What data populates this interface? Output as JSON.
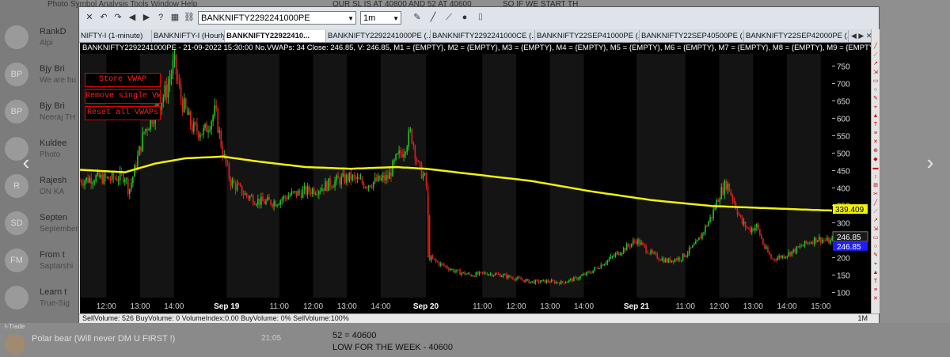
{
  "background": {
    "chats": [
      {
        "avatar": "",
        "title": "RankD",
        "sub": "Alpi"
      },
      {
        "avatar": "BP",
        "title": "Bjy Bri",
        "sub": "We are bu"
      },
      {
        "avatar": "BP",
        "title": "Bjy Bri",
        "sub": "Neeraj TH"
      },
      {
        "avatar": "",
        "title": "Kuldee",
        "sub": "Photo"
      },
      {
        "avatar": "R",
        "title": "Rajesh",
        "sub": "ON KA"
      },
      {
        "avatar": "SD",
        "title": "Septen",
        "sub": "September"
      },
      {
        "avatar": "FM",
        "title": "From t",
        "sub": "Saptarshi"
      },
      {
        "avatar": "",
        "title": "Learn t",
        "sub": "True-Sig"
      }
    ],
    "menu_text": "Photo   Symbol   Analysis   Tools   Window   Help",
    "top_msg_1": "OUR SL IS AT 40800 AND 52 AT 40600",
    "top_msg_2": "SO IF WE START TH",
    "bottom_sender": "Polar bear (Will never DM U FIRST !)",
    "bottom_time": "21:05",
    "bottom_line_1": "52 = 40600",
    "bottom_line_2": "LOW FOR THE WEEK - 40600",
    "app_label": "I-Trade"
  },
  "toolbar": {
    "symbol": "BANKNIFTY2292241000PE",
    "timeframe": "1m",
    "icons": [
      "close-icon",
      "undo-icon",
      "redo-icon",
      "back-icon",
      "forward-icon",
      "help-icon",
      "grid-icon",
      "link-icon"
    ]
  },
  "tabs": [
    {
      "label": "NIFTY-I (1-minute)",
      "active": false
    },
    {
      "label": "BANKNIFTY-I (Hourly)",
      "active": false
    },
    {
      "label": "BANKNIFTY22922410...",
      "active": true
    },
    {
      "label": "BANKNIFTY2292241000PE (...",
      "active": false
    },
    {
      "label": "BANKNIFTY2292241000CE (...",
      "active": false
    },
    {
      "label": "BANKNIFTY22SEP41000PE (...",
      "active": false
    },
    {
      "label": "BANKNIFTY22SEP40500PE (...",
      "active": false
    },
    {
      "label": "BANKNIFTY22SEP42000PE (...",
      "active": false
    }
  ],
  "info_bar": "BANKNIFTY2292241000PE - 21-09-2022 15:30:00 No.VWAPs: 34 Close:  246.85, V: 246.85, M1 = {EMPTY}, M2 = {EMPTY}, M3 = {EMPTY}, M4 = {EMPTY}, M5 = {EMPTY}, M6 = {EMPTY}, M7 = {EMPTY}, M8 = {EMPTY}, M9 = {EMPTY}, M10",
  "buttons": {
    "store_vwap": "Store VWAP",
    "remove_single": "Remove single VWAP",
    "reset_all": "Reset all VWAPs"
  },
  "status_bar": "SellVolume:  526   BuyVolume:    0   VolumeIndex:0.00   BuyVolume: 0%   SellVolume:100%",
  "status_right": "1M",
  "colors": {
    "up": "#22c322",
    "down": "#e02020",
    "vwap": "#f2f20a",
    "vwap_label_bg": "#f2f20a",
    "price_label_bg": "#1c1cff"
  },
  "chart_data": {
    "type": "line",
    "title": "",
    "y_ticks": [
      100,
      150,
      200,
      250,
      300,
      350,
      400,
      450,
      500,
      550,
      600,
      650,
      700,
      750
    ],
    "ylim": [
      85,
      785
    ],
    "x_ticks": [
      {
        "label": "12:00",
        "x": 0.035
      },
      {
        "label": "13:00",
        "x": 0.08
      },
      {
        "label": "14:00",
        "x": 0.125
      },
      {
        "label": "Sep 19",
        "x": 0.195,
        "bold": true
      },
      {
        "label": "11:00",
        "x": 0.265
      },
      {
        "label": "12:00",
        "x": 0.31
      },
      {
        "label": "13:00",
        "x": 0.355
      },
      {
        "label": "14:00",
        "x": 0.4
      },
      {
        "label": "Sep 20",
        "x": 0.46,
        "bold": true
      },
      {
        "label": "11:00",
        "x": 0.535
      },
      {
        "label": "12:00",
        "x": 0.58
      },
      {
        "label": "13:00",
        "x": 0.625
      },
      {
        "label": "14:00",
        "x": 0.67
      },
      {
        "label": "Sep 21",
        "x": 0.74,
        "bold": true
      },
      {
        "label": "11:00",
        "x": 0.805
      },
      {
        "label": "12:00",
        "x": 0.85
      },
      {
        "label": "13:00",
        "x": 0.895
      },
      {
        "label": "14:00",
        "x": 0.94
      },
      {
        "label": "15:00",
        "x": 0.985
      }
    ],
    "price_path": [
      [
        0.0,
        420
      ],
      [
        0.02,
        430
      ],
      [
        0.04,
        425
      ],
      [
        0.06,
        435
      ],
      [
        0.065,
        390
      ],
      [
        0.075,
        470
      ],
      [
        0.085,
        560
      ],
      [
        0.1,
        620
      ],
      [
        0.115,
        680
      ],
      [
        0.125,
        760
      ],
      [
        0.135,
        650
      ],
      [
        0.15,
        570
      ],
      [
        0.165,
        560
      ],
      [
        0.18,
        620
      ],
      [
        0.19,
        500
      ],
      [
        0.2,
        420
      ],
      [
        0.22,
        380
      ],
      [
        0.24,
        360
      ],
      [
        0.26,
        360
      ],
      [
        0.28,
        380
      ],
      [
        0.3,
        390
      ],
      [
        0.32,
        400
      ],
      [
        0.34,
        420
      ],
      [
        0.36,
        430
      ],
      [
        0.38,
        410
      ],
      [
        0.395,
        420
      ],
      [
        0.41,
        430
      ],
      [
        0.42,
        480
      ],
      [
        0.43,
        510
      ],
      [
        0.44,
        560
      ],
      [
        0.45,
        460
      ],
      [
        0.46,
        420
      ],
      [
        0.462,
        370
      ],
      [
        0.464,
        200
      ],
      [
        0.48,
        180
      ],
      [
        0.5,
        160
      ],
      [
        0.52,
        150
      ],
      [
        0.54,
        155
      ],
      [
        0.56,
        150
      ],
      [
        0.58,
        140
      ],
      [
        0.6,
        130
      ],
      [
        0.62,
        132
      ],
      [
        0.64,
        128
      ],
      [
        0.66,
        140
      ],
      [
        0.68,
        160
      ],
      [
        0.7,
        190
      ],
      [
        0.72,
        220
      ],
      [
        0.74,
        250
      ],
      [
        0.76,
        210
      ],
      [
        0.78,
        190
      ],
      [
        0.8,
        200
      ],
      [
        0.82,
        240
      ],
      [
        0.84,
        320
      ],
      [
        0.85,
        380
      ],
      [
        0.86,
        415
      ],
      [
        0.87,
        360
      ],
      [
        0.88,
        300
      ],
      [
        0.89,
        280
      ],
      [
        0.9,
        290
      ],
      [
        0.91,
        230
      ],
      [
        0.92,
        195
      ],
      [
        0.935,
        205
      ],
      [
        0.95,
        220
      ],
      [
        0.965,
        240
      ],
      [
        0.98,
        255
      ],
      [
        0.995,
        247
      ]
    ],
    "vwap_path": [
      [
        0.0,
        452
      ],
      [
        0.06,
        445
      ],
      [
        0.1,
        470
      ],
      [
        0.14,
        485
      ],
      [
        0.19,
        490
      ],
      [
        0.24,
        475
      ],
      [
        0.3,
        460
      ],
      [
        0.36,
        455
      ],
      [
        0.42,
        460
      ],
      [
        0.46,
        455
      ],
      [
        0.52,
        440
      ],
      [
        0.6,
        420
      ],
      [
        0.68,
        390
      ],
      [
        0.76,
        365
      ],
      [
        0.84,
        348
      ],
      [
        0.9,
        343
      ],
      [
        0.96,
        338
      ],
      [
        1.0,
        335
      ]
    ],
    "vwap_value": "339.409",
    "last_value": "246.85",
    "last_value_2": "246.85"
  }
}
